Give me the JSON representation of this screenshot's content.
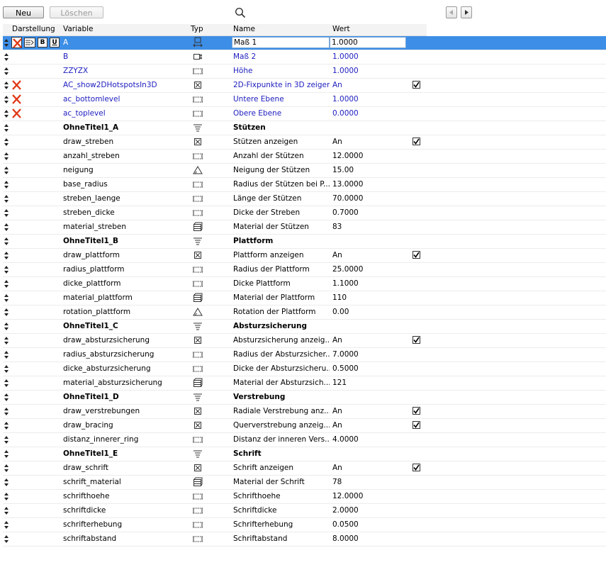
{
  "toolbar": {
    "new_label": "Neu",
    "delete_label": "Löschen"
  },
  "columns": {
    "display": "Darstellung",
    "variable": "Variable",
    "type": "Typ",
    "name": "Name",
    "value": "Wert"
  },
  "display_buttons": {
    "bold": "B",
    "underline": "U"
  },
  "rows": [
    {
      "variable": "A",
      "type": "length-icon",
      "name": "Maß 1",
      "value": "1.0000",
      "blue": false,
      "bold": false,
      "hidden": true,
      "checkbox": false
    },
    {
      "variable": "B",
      "type": "length-icon",
      "name": "Maß 2",
      "value": "1.0000",
      "blue": true,
      "bold": false,
      "hidden": false,
      "checkbox": false
    },
    {
      "variable": "ZZYZX",
      "type": "length-icon",
      "name": "Höhe",
      "value": "1.0000",
      "blue": true,
      "bold": false,
      "hidden": false,
      "checkbox": false
    },
    {
      "variable": "AC_show2DHotspotsIn3D",
      "type": "boolean-icon",
      "name": "2D-Fixpunkte in 3D zeigen",
      "value": "An",
      "blue": true,
      "bold": false,
      "hidden": true,
      "checkbox": true
    },
    {
      "variable": "ac_bottomlevel",
      "type": "length-icon",
      "name": "Untere Ebene",
      "value": "1.0000",
      "blue": true,
      "bold": false,
      "hidden": true,
      "checkbox": false
    },
    {
      "variable": "ac_toplevel",
      "type": "length-icon",
      "name": "Obere Ebene",
      "value": "0.0000",
      "blue": true,
      "bold": false,
      "hidden": true,
      "checkbox": false
    },
    {
      "variable": "OhneTitel1_A",
      "type": "title-icon",
      "name": "Stützen",
      "value": "",
      "blue": false,
      "bold": true,
      "hidden": false,
      "checkbox": false
    },
    {
      "variable": "draw_streben",
      "type": "boolean-icon",
      "name": "Stützen anzeigen",
      "value": "An",
      "blue": false,
      "bold": false,
      "hidden": false,
      "checkbox": true
    },
    {
      "variable": "anzahl_streben",
      "type": "length-icon",
      "name": "Anzahl der Stützen",
      "value": "12.0000",
      "blue": false,
      "bold": false,
      "hidden": false,
      "checkbox": false
    },
    {
      "variable": "neigung",
      "type": "angle-icon",
      "name": "Neigung der Stützen",
      "value": "15.00",
      "blue": false,
      "bold": false,
      "hidden": false,
      "checkbox": false
    },
    {
      "variable": "base_radius",
      "type": "length-icon",
      "name": "Radius der Stützen bei P...",
      "value": "13.0000",
      "blue": false,
      "bold": false,
      "hidden": false,
      "checkbox": false
    },
    {
      "variable": "streben_laenge",
      "type": "length-icon",
      "name": "Länge der Stützen",
      "value": "70.0000",
      "blue": false,
      "bold": false,
      "hidden": false,
      "checkbox": false
    },
    {
      "variable": "streben_dicke",
      "type": "length-icon",
      "name": "Dicke der Streben",
      "value": "0.7000",
      "blue": false,
      "bold": false,
      "hidden": false,
      "checkbox": false
    },
    {
      "variable": "material_streben",
      "type": "material-icon",
      "name": "Material der Stützen",
      "value": "83",
      "blue": false,
      "bold": false,
      "hidden": false,
      "checkbox": false
    },
    {
      "variable": "OhneTitel1_B",
      "type": "title-icon",
      "name": "Plattform",
      "value": "",
      "blue": false,
      "bold": true,
      "hidden": false,
      "checkbox": false
    },
    {
      "variable": "draw_plattform",
      "type": "boolean-icon",
      "name": "Plattform anzeigen",
      "value": "An",
      "blue": false,
      "bold": false,
      "hidden": false,
      "checkbox": true
    },
    {
      "variable": "radius_plattform",
      "type": "length-icon",
      "name": "Radius der Plattform",
      "value": "25.0000",
      "blue": false,
      "bold": false,
      "hidden": false,
      "checkbox": false
    },
    {
      "variable": "dicke_plattform",
      "type": "length-icon",
      "name": "Dicke Plattform",
      "value": "1.1000",
      "blue": false,
      "bold": false,
      "hidden": false,
      "checkbox": false
    },
    {
      "variable": "material_plattform",
      "type": "material-icon",
      "name": "Material der Plattform",
      "value": "110",
      "blue": false,
      "bold": false,
      "hidden": false,
      "checkbox": false
    },
    {
      "variable": "rotation_plattform",
      "type": "angle-icon",
      "name": "Rotation der Plattform",
      "value": "0.00",
      "blue": false,
      "bold": false,
      "hidden": false,
      "checkbox": false
    },
    {
      "variable": "OhneTitel1_C",
      "type": "title-icon",
      "name": "Absturzsicherung",
      "value": "",
      "blue": false,
      "bold": true,
      "hidden": false,
      "checkbox": false
    },
    {
      "variable": "draw_absturzsicherung",
      "type": "boolean-icon",
      "name": "Absturzsicherung anzeig...",
      "value": "An",
      "blue": false,
      "bold": false,
      "hidden": false,
      "checkbox": true
    },
    {
      "variable": "radius_absturzsicherung",
      "type": "length-icon",
      "name": "Radius der Absturzsicher...",
      "value": "7.0000",
      "blue": false,
      "bold": false,
      "hidden": false,
      "checkbox": false
    },
    {
      "variable": "dicke_absturzsicherung",
      "type": "length-icon",
      "name": "Dicke der Absturzsicheru...",
      "value": "0.5000",
      "blue": false,
      "bold": false,
      "hidden": false,
      "checkbox": false
    },
    {
      "variable": "material_absturzsicherung",
      "type": "material-icon",
      "name": "Material der Absturzsich...",
      "value": "121",
      "blue": false,
      "bold": false,
      "hidden": false,
      "checkbox": false
    },
    {
      "variable": "OhneTitel1_D",
      "type": "title-icon",
      "name": "Verstrebung",
      "value": "",
      "blue": false,
      "bold": true,
      "hidden": false,
      "checkbox": false
    },
    {
      "variable": "draw_verstrebungen",
      "type": "boolean-icon",
      "name": "Radiale Verstrebung anz...",
      "value": "An",
      "blue": false,
      "bold": false,
      "hidden": false,
      "checkbox": true
    },
    {
      "variable": "draw_bracing",
      "type": "boolean-icon",
      "name": "Querverstrebung anzeig...",
      "value": "An",
      "blue": false,
      "bold": false,
      "hidden": false,
      "checkbox": true
    },
    {
      "variable": "distanz_innerer_ring",
      "type": "length-icon",
      "name": "Distanz der inneren Vers...",
      "value": "4.0000",
      "blue": false,
      "bold": false,
      "hidden": false,
      "checkbox": false
    },
    {
      "variable": "OhneTitel1_E",
      "type": "title-icon",
      "name": "Schrift",
      "value": "",
      "blue": false,
      "bold": true,
      "hidden": false,
      "checkbox": false
    },
    {
      "variable": "draw_schrift",
      "type": "boolean-icon",
      "name": "Schrift anzeigen",
      "value": "An",
      "blue": false,
      "bold": false,
      "hidden": false,
      "checkbox": true
    },
    {
      "variable": "schrift_material",
      "type": "material-icon",
      "name": "Material der Schrift",
      "value": "78",
      "blue": false,
      "bold": false,
      "hidden": false,
      "checkbox": false
    },
    {
      "variable": "schrifthoehe",
      "type": "length-icon",
      "name": "Schrifthoehe",
      "value": "12.0000",
      "blue": false,
      "bold": false,
      "hidden": false,
      "checkbox": false
    },
    {
      "variable": "schriftdicke",
      "type": "length-icon",
      "name": "Schriftdicke",
      "value": "2.0000",
      "blue": false,
      "bold": false,
      "hidden": false,
      "checkbox": false
    },
    {
      "variable": "schrifterhebung",
      "type": "length-icon",
      "name": "Schrifterhebung",
      "value": "0.0500",
      "blue": false,
      "bold": false,
      "hidden": false,
      "checkbox": false
    },
    {
      "variable": "schriftabstand",
      "type": "length-icon",
      "name": "Schriftabstand",
      "value": "8.0000",
      "blue": false,
      "bold": false,
      "hidden": false,
      "checkbox": false
    }
  ],
  "colors": {
    "selection": "#3d8ee6",
    "linked_text": "#2020c0",
    "hidden_x": "#e03a1a"
  }
}
